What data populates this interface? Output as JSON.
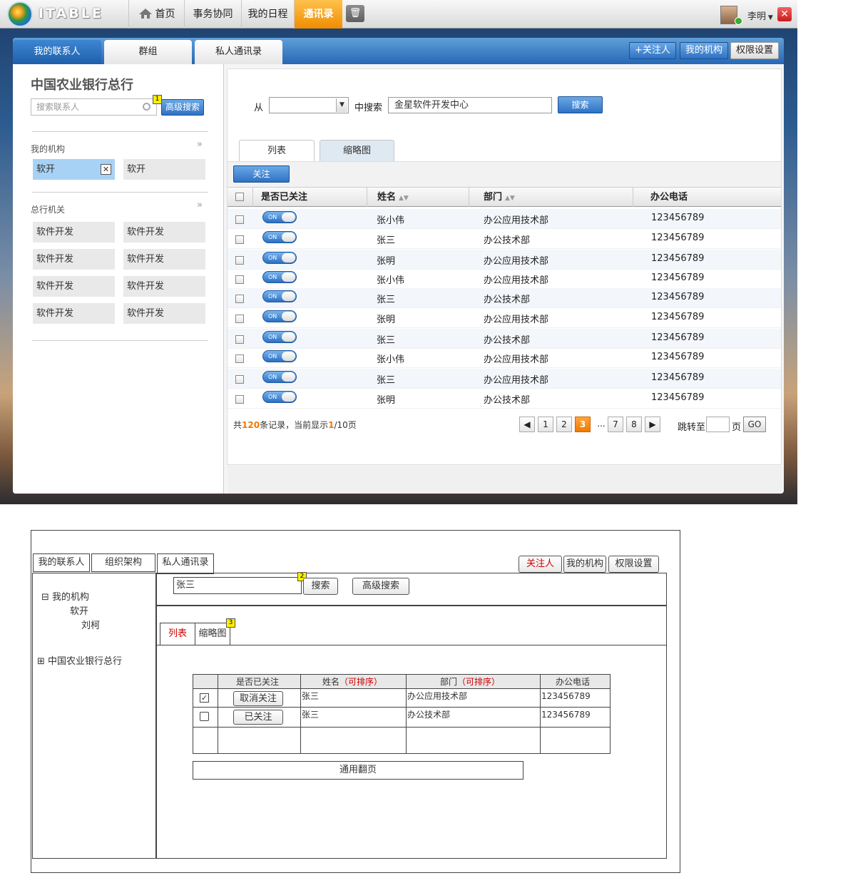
{
  "app": {
    "logo_text": "ITABLE",
    "nav": [
      "首页",
      "事务协同",
      "我的日程",
      "通讯录"
    ],
    "active_nav": "通讯录",
    "trash_icon": "trash-icon",
    "user": "李明",
    "user_menu_icon": "caret-down-icon",
    "close_icon": "close-icon"
  },
  "tabs": {
    "items": [
      "我的联系人",
      "群组",
      "私人通讯录"
    ],
    "active": "我的联系人"
  },
  "tools": {
    "follow": "+关注人",
    "my_org": "我的机构",
    "perm": "权限设置"
  },
  "left": {
    "title": "中国农业银行总行",
    "search_placeholder": "搜索联系人",
    "adv": "高级搜索",
    "badge": "1",
    "my_org_label": "我的机构",
    "my_org_items": [
      "软开",
      "软开"
    ],
    "hq_label": "总行机关",
    "hq_items": [
      "软件开发",
      "软件开发",
      "软件开发",
      "软件开发",
      "软件开发",
      "软件开发",
      "软件开发",
      "软件开发"
    ],
    "chevron": "»"
  },
  "search": {
    "from": "从",
    "in_search": "中搜索",
    "keyword": "金星软件开发中心",
    "btn": "搜索"
  },
  "view": {
    "tabs": [
      "列表",
      "缩略图"
    ],
    "follow_btn": "关注"
  },
  "table": {
    "headers": [
      "是否已关注",
      "姓名",
      "部门",
      "办公电话"
    ],
    "toggle_text": "ON",
    "rows": [
      {
        "name": "张小伟",
        "dept": "办公应用技术部",
        "phone": "123456789"
      },
      {
        "name": "张三",
        "dept": "办公技术部",
        "phone": "123456789"
      },
      {
        "name": "张明",
        "dept": "办公应用技术部",
        "phone": "123456789"
      },
      {
        "name": "张小伟",
        "dept": "办公应用技术部",
        "phone": "123456789"
      },
      {
        "name": "张三",
        "dept": "办公技术部",
        "phone": "123456789"
      },
      {
        "name": "张明",
        "dept": "办公应用技术部",
        "phone": "123456789"
      },
      {
        "name": "张三",
        "dept": "办公技术部",
        "phone": "123456789"
      },
      {
        "name": "张小伟",
        "dept": "办公应用技术部",
        "phone": "123456789"
      },
      {
        "name": "张三",
        "dept": "办公应用技术部",
        "phone": "123456789"
      },
      {
        "name": "张明",
        "dept": "办公技术部",
        "phone": "123456789"
      }
    ]
  },
  "pager": {
    "pre": "共",
    "total": "120",
    "mid": "条记录，当前显示",
    "page": "1",
    "post": "/10页",
    "prev": "◀",
    "pages": [
      "1",
      "2",
      "3",
      "...",
      "7",
      "8"
    ],
    "current": "3",
    "next": "▶",
    "jump": "跳转至",
    "page_unit": "页",
    "go": "GO"
  },
  "wire": {
    "tabs": [
      "我的联系人",
      "组织架构",
      "私人通讯录"
    ],
    "btns": [
      "关注人",
      "我的机构",
      "权限设置"
    ],
    "tree": [
      {
        "sign": "⊟",
        "label": "我的机构"
      },
      {
        "label": "软开"
      },
      {
        "label": "刘柯"
      },
      {
        "sign": "⊞",
        "label": "中国农业银行总行"
      }
    ],
    "search_value": "张三",
    "badge2": "2",
    "search_btn": "搜索",
    "adv_btn": "高级搜索",
    "view_tabs": [
      "列表",
      "缩略图"
    ],
    "badge3": "3",
    "headers": [
      "是否已关注",
      "姓名",
      "部门",
      "办公电话"
    ],
    "sortable": "（可排序）",
    "rows": [
      {
        "btn": "取消关注",
        "name": "张三",
        "dept": "办公应用技术部",
        "phone": "123456789",
        "checked": true
      },
      {
        "btn": "已关注",
        "name": "张三",
        "dept": "办公技术部",
        "phone": "123456789",
        "checked": false
      }
    ],
    "pager": "通用翻页"
  }
}
